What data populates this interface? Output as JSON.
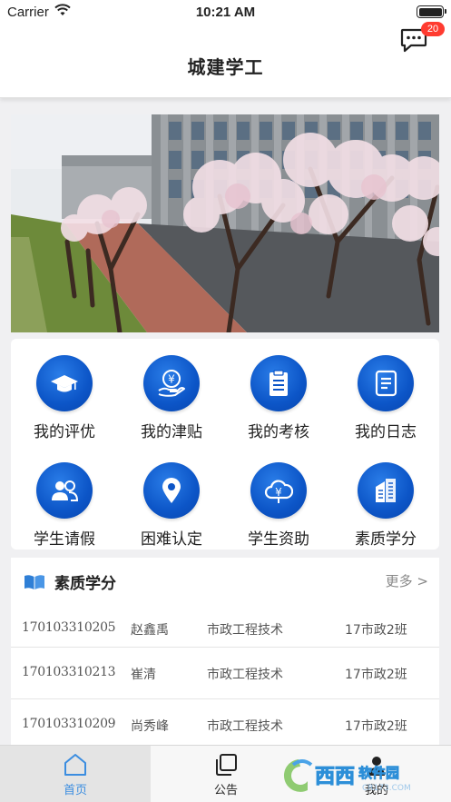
{
  "status_bar": {
    "carrier": "Carrier",
    "time": "10:21 AM"
  },
  "header": {
    "title": "城建学工",
    "message_badge": "20"
  },
  "grid": [
    {
      "label": "我的评优",
      "icon": "graduation-cap-icon"
    },
    {
      "label": "我的津贴",
      "icon": "yuan-hand-icon"
    },
    {
      "label": "我的考核",
      "icon": "clipboard-icon"
    },
    {
      "label": "我的日志",
      "icon": "journal-icon"
    },
    {
      "label": "学生请假",
      "icon": "people-icon"
    },
    {
      "label": "困难认定",
      "icon": "location-pin-icon"
    },
    {
      "label": "学生资助",
      "icon": "yuan-cloud-icon"
    },
    {
      "label": "素质学分",
      "icon": "buildings-icon"
    }
  ],
  "score_section": {
    "title": "素质学分",
    "more": "更多 >",
    "rows": [
      {
        "id": "170103310205",
        "name": "赵鑫禹",
        "major": "市政工程技术",
        "class": "17市政2班"
      },
      {
        "id": "170103310213",
        "name": "崔清",
        "major": "市政工程技术",
        "class": "17市政2班"
      },
      {
        "id": "170103310209",
        "name": "尚秀峰",
        "major": "市政工程技术",
        "class": "17市政2班"
      }
    ]
  },
  "tabs": [
    {
      "label": "首页",
      "icon": "home-icon",
      "active": true
    },
    {
      "label": "公告",
      "icon": "notice-icon",
      "active": false
    },
    {
      "label": "我的",
      "icon": "person-icon",
      "active": false
    }
  ],
  "watermark": {
    "text": "西西软件园",
    "sub": "CR173.COM"
  },
  "colors": {
    "accent": "#0c55c7",
    "tab_active": "#3b8de0",
    "badge": "#ff3b30"
  }
}
